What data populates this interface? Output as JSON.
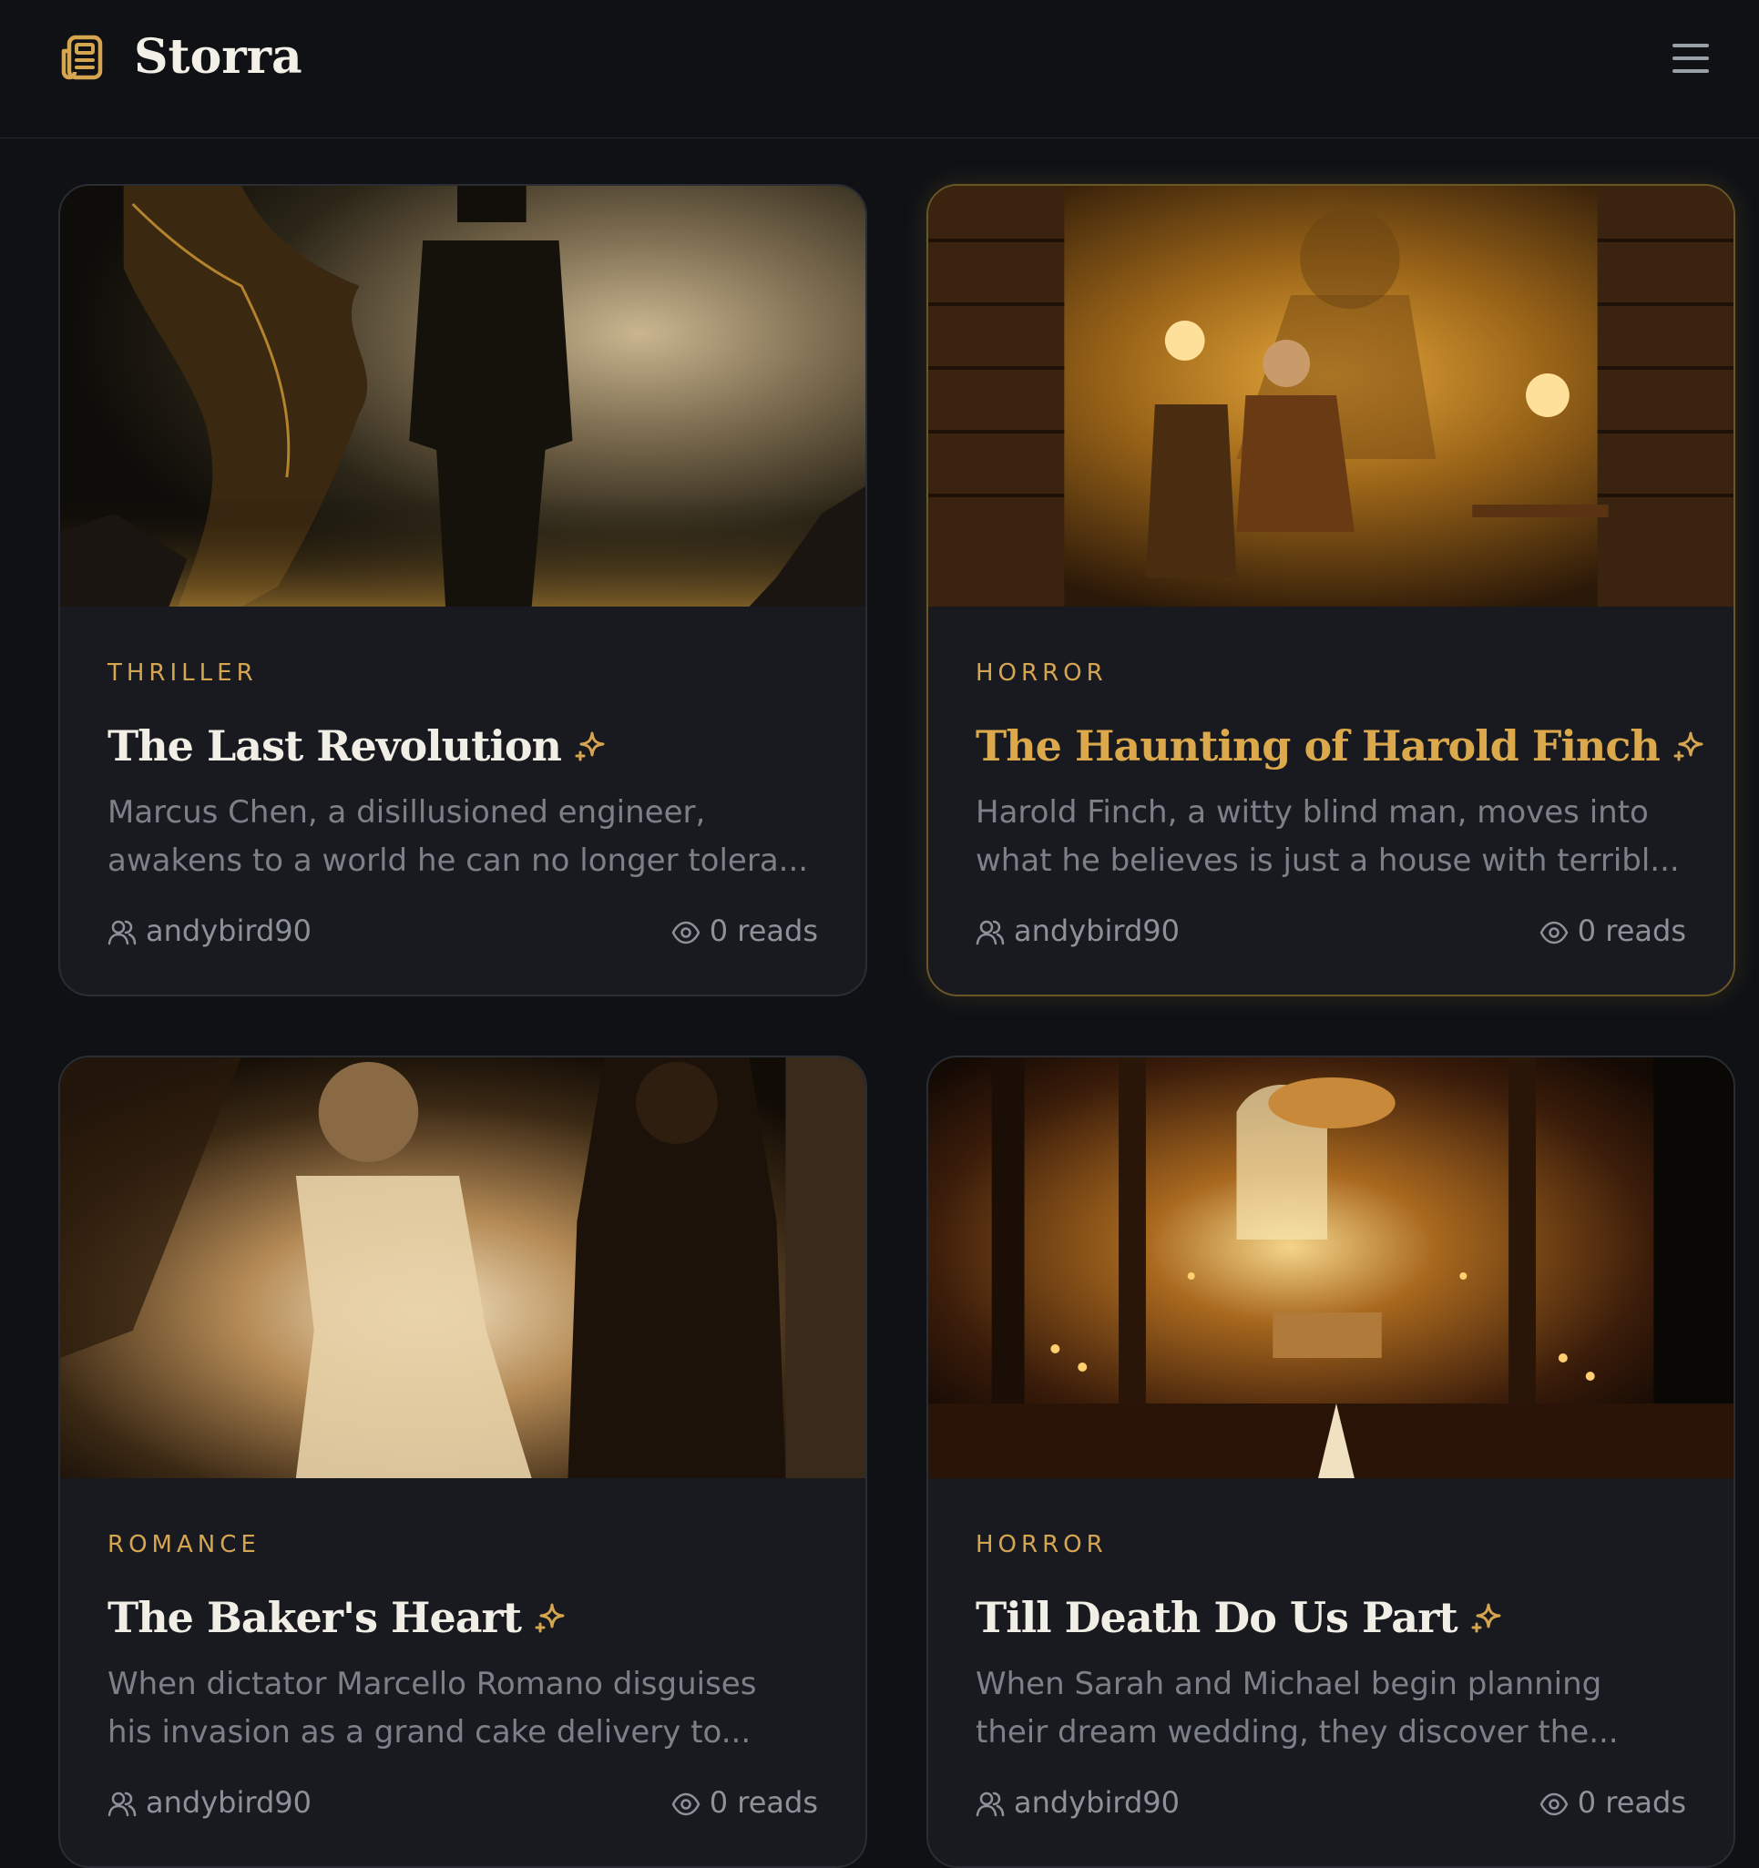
{
  "app": {
    "brand": "Storra",
    "logo_icon": "newspaper-icon",
    "menu_icon": "hamburger-menu-icon",
    "accent_color": "#d6a550"
  },
  "stories": [
    {
      "genre": "THRILLER",
      "title": "The Last Revolution",
      "description_lines": [
        "Marcus Chen, a disillusioned engineer,",
        "awakens to a world he can no longer tolera..."
      ],
      "author": "andybird90",
      "reads": "0 reads",
      "highlighted": false,
      "image_subject": "man in suit facing glowing earth"
    },
    {
      "genre": "HORROR",
      "title": "The Haunting of Harold Finch",
      "description_lines": [
        "Harold Finch, a witty blind man, moves into",
        "what he believes is just a house with terribl..."
      ],
      "author": "andybird90",
      "reads": "0 reads",
      "highlighted": true,
      "image_subject": "old man reading in library by lamplight"
    },
    {
      "genre": "ROMANCE",
      "title": "The Baker's Heart",
      "description_lines": [
        "When dictator Marcello Romano disguises",
        "his invasion as a grand cake delivery to..."
      ],
      "author": "andybird90",
      "reads": "0 reads",
      "highlighted": false,
      "image_subject": "glowing woman and shadowed man"
    },
    {
      "genre": "HORROR",
      "title": "Till Death Do Us Part",
      "description_lines": [
        "When Sarah and Michael begin planning",
        "their dream wedding, they discover the..."
      ],
      "author": "andybird90",
      "reads": "0 reads",
      "highlighted": false,
      "image_subject": "candlelit gothic chapel"
    }
  ]
}
